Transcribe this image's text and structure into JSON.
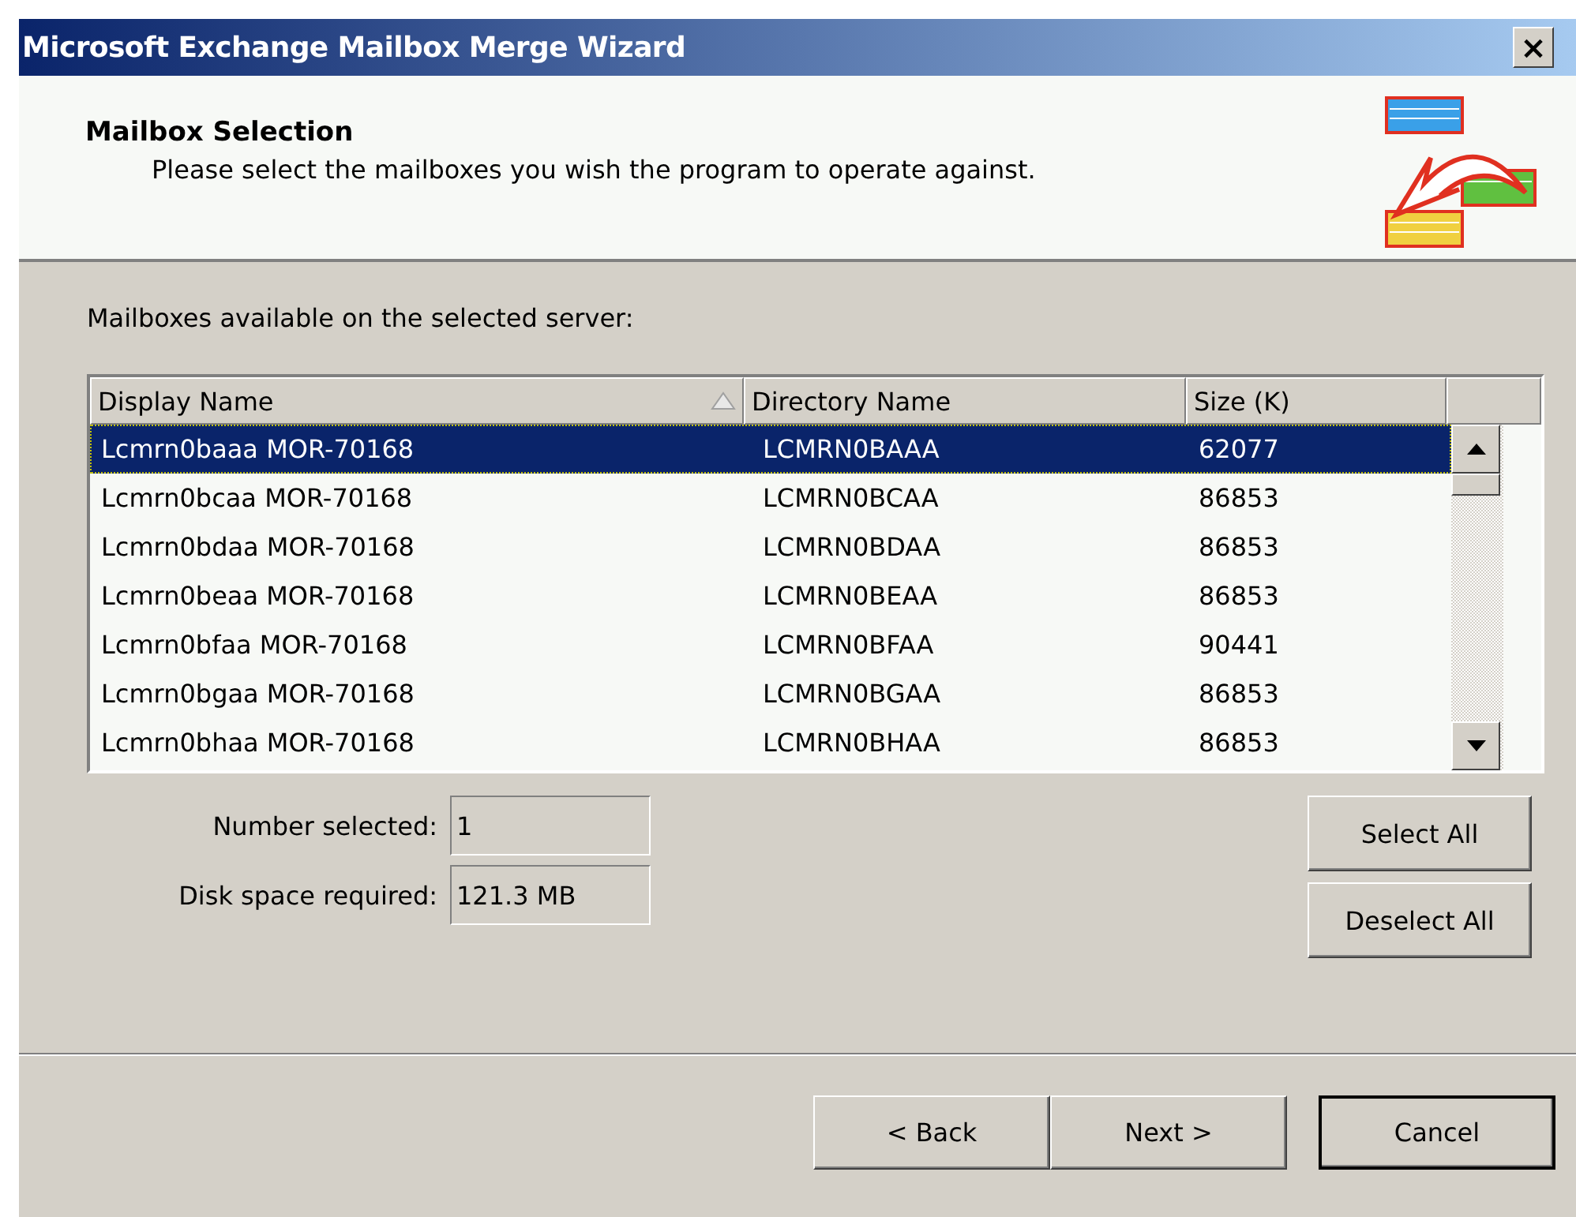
{
  "window": {
    "title": "Microsoft Exchange Mailbox Merge Wizard",
    "close": "×"
  },
  "header": {
    "title": "Mailbox Selection",
    "subtitle": "Please select the mailboxes you wish the program to operate against."
  },
  "list_label": "Mailboxes available on the selected server:",
  "table": {
    "columns": [
      {
        "label": "Display Name",
        "sorted": true
      },
      {
        "label": "Directory Name",
        "sorted": false
      },
      {
        "label": "Size (K)",
        "sorted": false
      }
    ],
    "rows": [
      {
        "cells": [
          "Lcmrn0baaa MOR-70168",
          "LCMRN0BAAA",
          "62077"
        ],
        "selected": true
      },
      {
        "cells": [
          "Lcmrn0bcaa MOR-70168",
          "LCMRN0BCAA",
          "86853"
        ],
        "selected": false
      },
      {
        "cells": [
          "Lcmrn0bdaa MOR-70168",
          "LCMRN0BDAA",
          "86853"
        ],
        "selected": false
      },
      {
        "cells": [
          "Lcmrn0beaa MOR-70168",
          "LCMRN0BEAA",
          "86853"
        ],
        "selected": false
      },
      {
        "cells": [
          "Lcmrn0bfaa MOR-70168",
          "LCMRN0BFAA",
          "90441"
        ],
        "selected": false
      },
      {
        "cells": [
          "Lcmrn0bgaa MOR-70168",
          "LCMRN0BGAA",
          "86853"
        ],
        "selected": false
      },
      {
        "cells": [
          "Lcmrn0bhaa MOR-70168",
          "LCMRN0BHAA",
          "86853"
        ],
        "selected": false
      }
    ]
  },
  "fields": [
    {
      "label": "Number selected:",
      "value": "1"
    },
    {
      "label": "Disk space required:",
      "value": "121.3 MB"
    }
  ],
  "side_buttons": [
    "Select All",
    "Deselect All"
  ],
  "buttons": [
    {
      "label": "< Back",
      "default": false
    },
    {
      "label": "Next >",
      "default": false
    },
    {
      "label": "Cancel",
      "default": true
    }
  ]
}
